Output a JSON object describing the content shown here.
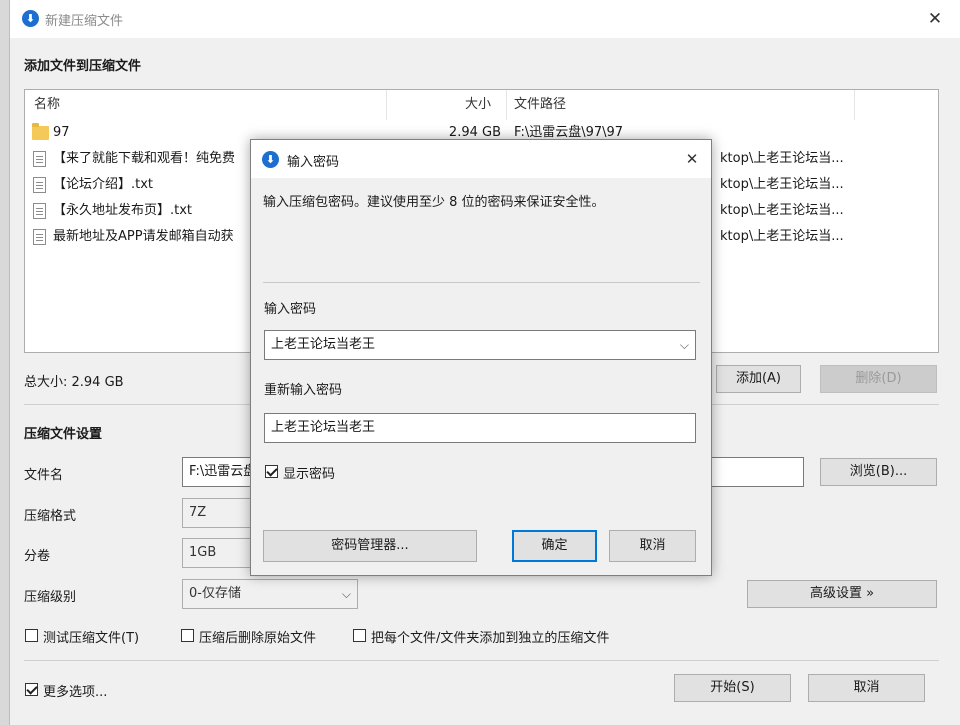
{
  "main_window": {
    "title": "新建压缩文件",
    "add_section_label": "添加文件到压缩文件",
    "columns": {
      "name": "名称",
      "size": "大小",
      "path": "文件路径"
    },
    "files": [
      {
        "name": "97",
        "size": "2.94 GB",
        "path": "F:\\迅雷云盘\\97\\97",
        "type": "folder"
      },
      {
        "name": "【来了就能下载和观看！纯免费",
        "size": "",
        "path": "ktop\\上老王论坛当...",
        "type": "file"
      },
      {
        "name": "【论坛介绍】.txt",
        "size": "",
        "path": "ktop\\上老王论坛当...",
        "type": "file"
      },
      {
        "name": "【永久地址发布页】.txt",
        "size": "",
        "path": "ktop\\上老王论坛当...",
        "type": "file"
      },
      {
        "name": "最新地址及APP请发邮箱自动获",
        "size": "",
        "path": "ktop\\上老王论坛当...",
        "type": "file"
      }
    ],
    "total_size": "总大小: 2.94 GB",
    "add_button": "添加(A)",
    "delete_button": "删除(D)",
    "settings_label": "压缩文件设置",
    "filename_label": "文件名",
    "filename_value": "F:\\迅雷云盘",
    "browse_button": "浏览(B)...",
    "format_label": "压缩格式",
    "format_value": "7Z",
    "split_label": "分卷",
    "split_value": "1GB",
    "level_label": "压缩级别",
    "level_value": "0-仅存储",
    "advanced_button": "高级设置 »",
    "test_checkbox": "测试压缩文件(T)",
    "delete_after_checkbox": "压缩后删除原始文件",
    "separate_checkbox": "把每个文件/文件夹添加到独立的压缩文件",
    "more_options_checkbox": "更多选项...",
    "start_button": "开始(S)",
    "cancel_button": "取消"
  },
  "dialog": {
    "title": "输入密码",
    "description": "输入压缩包密码。建议使用至少 8 位的密码来保证安全性。",
    "password_label": "输入密码",
    "password_value": "上老王论坛当老王",
    "reenter_label": "重新输入密码",
    "reenter_value": "上老王论坛当老王",
    "show_password": "显示密码",
    "manager_button": "密码管理器...",
    "ok_button": "确定",
    "cancel_button": "取消"
  },
  "colors": {
    "accent": "#0078d7",
    "app_icon": "#1c6fd0",
    "folder": "#f4c95a"
  }
}
